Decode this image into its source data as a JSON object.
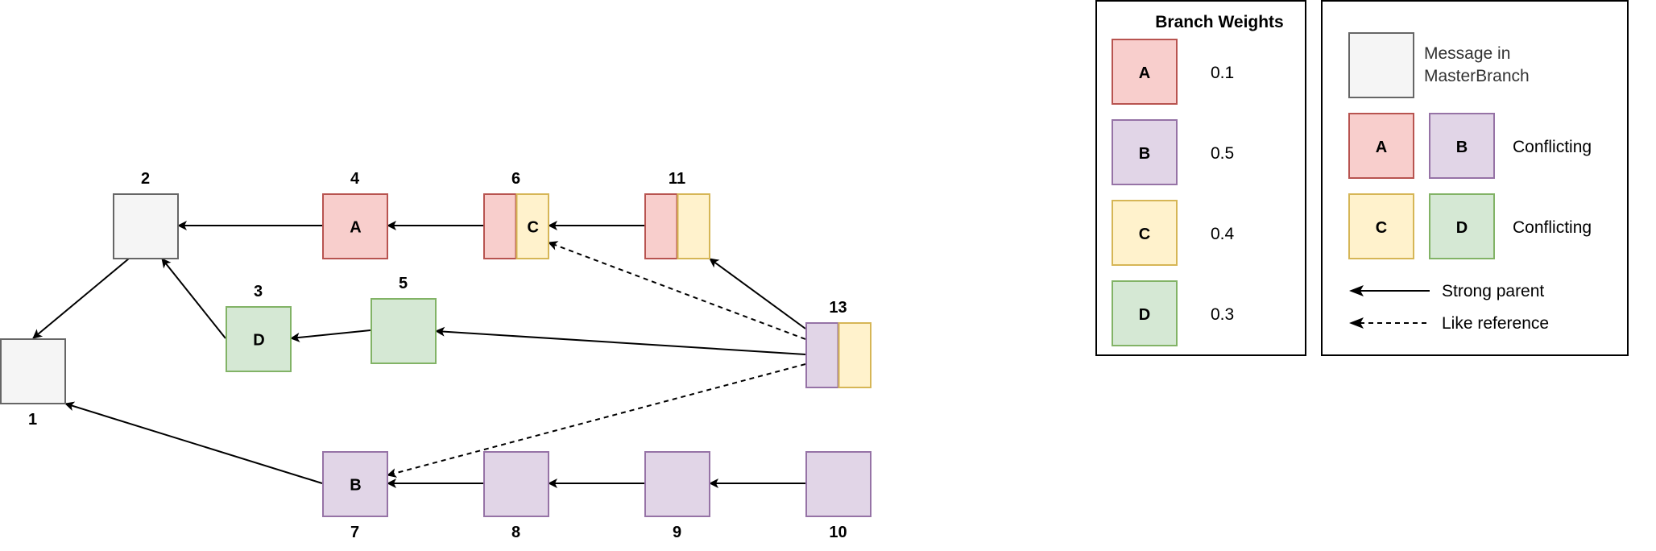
{
  "palette": {
    "master": {
      "fill": "#f5f5f5",
      "stroke": "#666666"
    },
    "A": {
      "fill": "#f8cecc",
      "stroke": "#b85450"
    },
    "B": {
      "fill": "#e1d5e7",
      "stroke": "#9673a6"
    },
    "C": {
      "fill": "#fff2cc",
      "stroke": "#d6b656"
    },
    "D": {
      "fill": "#d5e8d4",
      "stroke": "#82b366"
    },
    "edge": "#000000"
  },
  "graph": {
    "nodes": [
      {
        "id": "1",
        "label": "1",
        "branches": [
          "master"
        ],
        "letter": ""
      },
      {
        "id": "2",
        "label": "2",
        "branches": [
          "master"
        ],
        "letter": ""
      },
      {
        "id": "3",
        "label": "3",
        "branches": [
          "D"
        ],
        "letter": "D"
      },
      {
        "id": "4",
        "label": "4",
        "branches": [
          "A"
        ],
        "letter": "A"
      },
      {
        "id": "5",
        "label": "5",
        "branches": [
          "D"
        ],
        "letter": ""
      },
      {
        "id": "6",
        "label": "6",
        "branches": [
          "A",
          "C"
        ],
        "letter": "C"
      },
      {
        "id": "7",
        "label": "7",
        "branches": [
          "B"
        ],
        "letter": "B"
      },
      {
        "id": "8",
        "label": "8",
        "branches": [
          "B"
        ],
        "letter": ""
      },
      {
        "id": "9",
        "label": "9",
        "branches": [
          "B"
        ],
        "letter": ""
      },
      {
        "id": "10",
        "label": "10",
        "branches": [
          "B"
        ],
        "letter": ""
      },
      {
        "id": "11",
        "label": "11",
        "branches": [
          "A",
          "C"
        ],
        "letter": ""
      },
      {
        "id": "13",
        "label": "13",
        "branches": [
          "B",
          "C"
        ],
        "letter": ""
      }
    ],
    "edges": [
      {
        "from": "2",
        "to": "1",
        "type": "strong"
      },
      {
        "from": "3",
        "to": "2",
        "type": "strong"
      },
      {
        "from": "4",
        "to": "2",
        "type": "strong"
      },
      {
        "from": "5",
        "to": "3",
        "type": "strong"
      },
      {
        "from": "6",
        "to": "4",
        "type": "strong"
      },
      {
        "from": "11",
        "to": "6",
        "type": "strong"
      },
      {
        "from": "7",
        "to": "1",
        "type": "strong"
      },
      {
        "from": "8",
        "to": "7",
        "type": "strong"
      },
      {
        "from": "9",
        "to": "8",
        "type": "strong"
      },
      {
        "from": "10",
        "to": "9",
        "type": "strong"
      },
      {
        "from": "13",
        "to": "11",
        "type": "strong"
      },
      {
        "from": "13",
        "to": "5",
        "type": "strong"
      },
      {
        "from": "13",
        "to": "6",
        "type": "like"
      },
      {
        "from": "13",
        "to": "7",
        "type": "like"
      }
    ]
  },
  "weights_legend": {
    "title": "Branch Weights",
    "items": [
      {
        "branch": "A",
        "letter": "A",
        "weight": "0.1"
      },
      {
        "branch": "B",
        "letter": "B",
        "weight": "0.5"
      },
      {
        "branch": "C",
        "letter": "C",
        "weight": "0.4"
      },
      {
        "branch": "D",
        "letter": "D",
        "weight": "0.3"
      }
    ]
  },
  "key_legend": {
    "master_line1": "Message in",
    "master_line2": "MasterBranch",
    "conflicts": [
      {
        "left": "A",
        "right": "B",
        "label": "Conflicting"
      },
      {
        "left": "C",
        "right": "D",
        "label": "Conflicting"
      }
    ],
    "strong_label": "Strong parent",
    "like_label": "Like reference"
  }
}
